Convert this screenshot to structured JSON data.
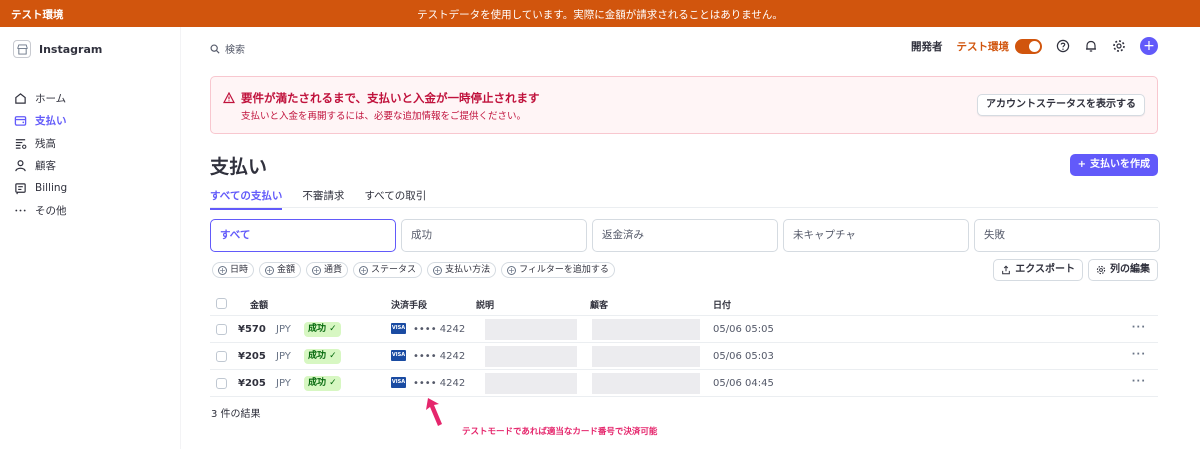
{
  "banner": {
    "env_label": "テスト環境",
    "message": "テストデータを使用しています。実際に金額が請求されることはありません。",
    "color": "#d1550d"
  },
  "brand": {
    "name": "Instagram"
  },
  "sidebar": {
    "items": [
      {
        "label": "ホーム",
        "icon": "home-icon",
        "active": false
      },
      {
        "label": "支払い",
        "icon": "wallet-icon",
        "active": true
      },
      {
        "label": "残高",
        "icon": "balance-icon",
        "active": false
      },
      {
        "label": "顧客",
        "icon": "user-icon",
        "active": false
      },
      {
        "label": "Billing",
        "icon": "billing-icon",
        "active": false
      },
      {
        "label": "その他",
        "icon": "more-icon",
        "active": false
      }
    ]
  },
  "header": {
    "search_placeholder": "検索",
    "developer_label": "開発者",
    "test_env_label": "テスト環境"
  },
  "alert": {
    "title": "要件が満たされるまで、支払いと入金が一時停止されます",
    "subtitle": "支払いと入金を再開するには、必要な追加情報をご提供ください。",
    "button_label": "アカウントステータスを表示する"
  },
  "page": {
    "title": "支払い",
    "create_label": "支払いを作成"
  },
  "tabs": [
    {
      "label": "すべての支払い",
      "active": true
    },
    {
      "label": "不審請求",
      "active": false
    },
    {
      "label": "すべての取引",
      "active": false
    }
  ],
  "status_filters": [
    {
      "label": "すべて",
      "active": true
    },
    {
      "label": "成功",
      "active": false
    },
    {
      "label": "返金済み",
      "active": false
    },
    {
      "label": "未キャプチャ",
      "active": false
    },
    {
      "label": "失敗",
      "active": false
    }
  ],
  "chips": [
    "日時",
    "金額",
    "通貨",
    "ステータス",
    "支払い方法",
    "フィルターを追加する"
  ],
  "actions": {
    "export_label": "エクスポート",
    "edit_columns_label": "列の編集"
  },
  "table": {
    "columns": {
      "amount": "金額",
      "method": "決済手段",
      "description": "説明",
      "customer": "顧客",
      "date": "日付"
    },
    "rows": [
      {
        "amount": "¥570",
        "currency": "JPY",
        "status": "成功",
        "card_brand": "VISA",
        "card": "•••• 4242",
        "date": "05/06 05:05"
      },
      {
        "amount": "¥205",
        "currency": "JPY",
        "status": "成功",
        "card_brand": "VISA",
        "card": "•••• 4242",
        "date": "05/06 05:03"
      },
      {
        "amount": "¥205",
        "currency": "JPY",
        "status": "成功",
        "card_brand": "VISA",
        "card": "•••• 4242",
        "date": "05/06 04:45"
      }
    ],
    "more_label": "···"
  },
  "results_text": "3 件の結果",
  "annotation": "テストモードであれば適当なカード番号で決済可能"
}
